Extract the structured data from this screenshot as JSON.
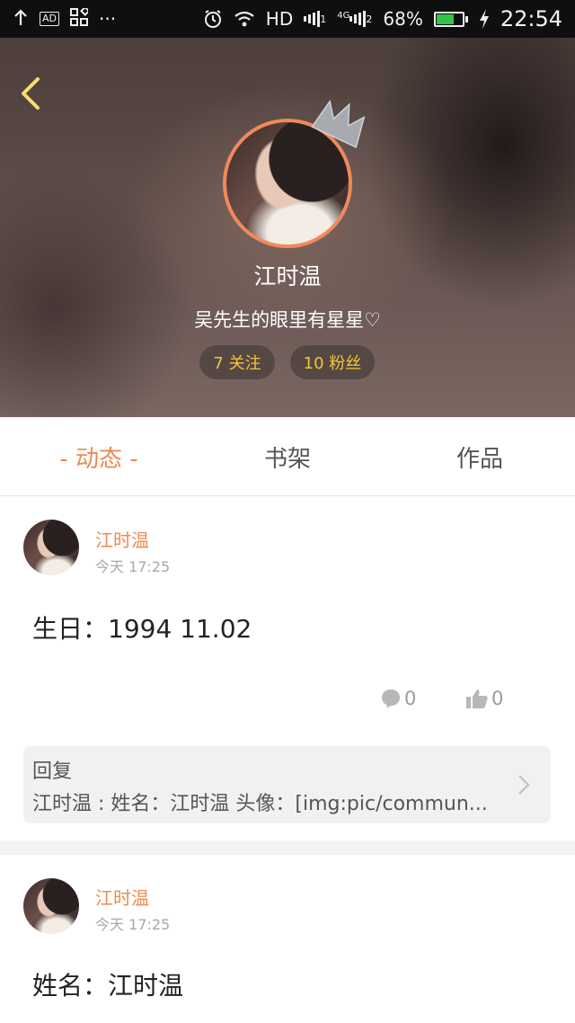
{
  "status_bar": {
    "hd": "HD",
    "network_4g": "4G",
    "sim1": "1",
    "sim2": "2",
    "battery_percent": "68%",
    "battery_level": 0.68,
    "time": "22:54",
    "icons": [
      "upload-arrow-icon",
      "ad-icon",
      "apps-icon",
      "more-dots-icon",
      "alarm-icon",
      "wifi-icon",
      "signal-icon",
      "battery-icon",
      "charging-icon"
    ]
  },
  "profile": {
    "name": "江时温",
    "bio": "吴先生的眼里有星星♡",
    "following_label": "7 关注",
    "fans_label": "10 粉丝",
    "colors": {
      "accent": "#ec8a52",
      "pill_text": "#f5c43a",
      "avatar_ring": "#f08a5a"
    }
  },
  "tabs": [
    {
      "label": "- 动态 -",
      "active": true
    },
    {
      "label": "书架",
      "active": false
    },
    {
      "label": "作品",
      "active": false
    }
  ],
  "posts": [
    {
      "author": "江时温",
      "time": "今天 17:25",
      "content": "生日：1994 11.02",
      "comments": "0",
      "likes": "0",
      "reply": {
        "title": "回复",
        "text": "江时温 : 姓名：江时温 头像：[img:pic/commun..."
      }
    },
    {
      "author": "江时温",
      "time": "今天 17:25",
      "content": "姓名：江时温"
    }
  ]
}
